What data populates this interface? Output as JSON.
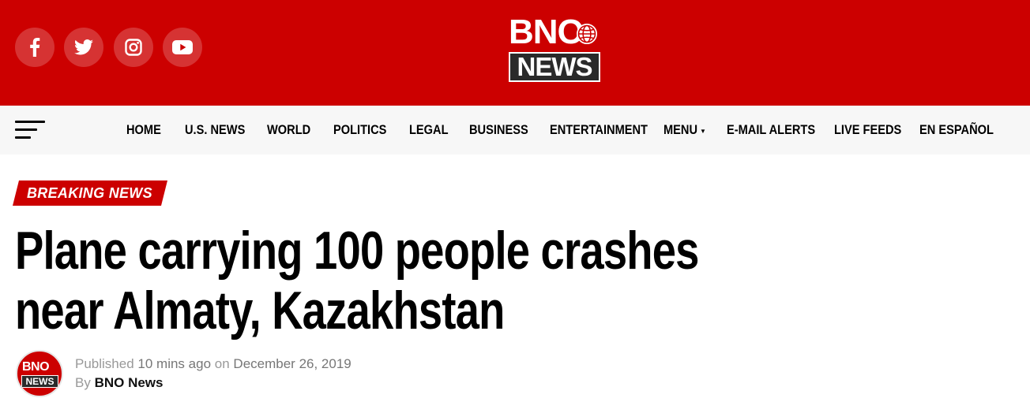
{
  "header": {
    "logo_top": "BNO",
    "logo_bottom": "NEWS",
    "social": [
      {
        "name": "facebook",
        "icon": "facebook-icon"
      },
      {
        "name": "twitter",
        "icon": "twitter-icon"
      },
      {
        "name": "instagram",
        "icon": "instagram-icon"
      },
      {
        "name": "youtube",
        "icon": "youtube-icon"
      }
    ],
    "brand_color": "#cc0000"
  },
  "nav": {
    "menu_icon": "hamburger-icon",
    "items": [
      {
        "label": "HOME"
      },
      {
        "label": "U.S. NEWS"
      },
      {
        "label": "WORLD"
      },
      {
        "label": "POLITICS"
      },
      {
        "label": "LEGAL"
      },
      {
        "label": "BUSINESS"
      },
      {
        "label": "ENTERTAINMENT"
      },
      {
        "label": "MENU"
      },
      {
        "label": "E-MAIL ALERTS"
      },
      {
        "label": "LIVE FEEDS"
      },
      {
        "label": "EN ESPAÑOL"
      }
    ]
  },
  "article": {
    "badge": "BREAKING NEWS",
    "headline": "Plane carrying 100 people crashes near Almaty, Kazakhstan",
    "meta": {
      "published_prefix": "Published",
      "relative_time": "10 mins ago",
      "on_word": "on",
      "date": "December 26, 2019",
      "by_word": "By",
      "author": "BNO News"
    },
    "avatar": {
      "top": "BNO",
      "bottom": "NEWS"
    }
  }
}
